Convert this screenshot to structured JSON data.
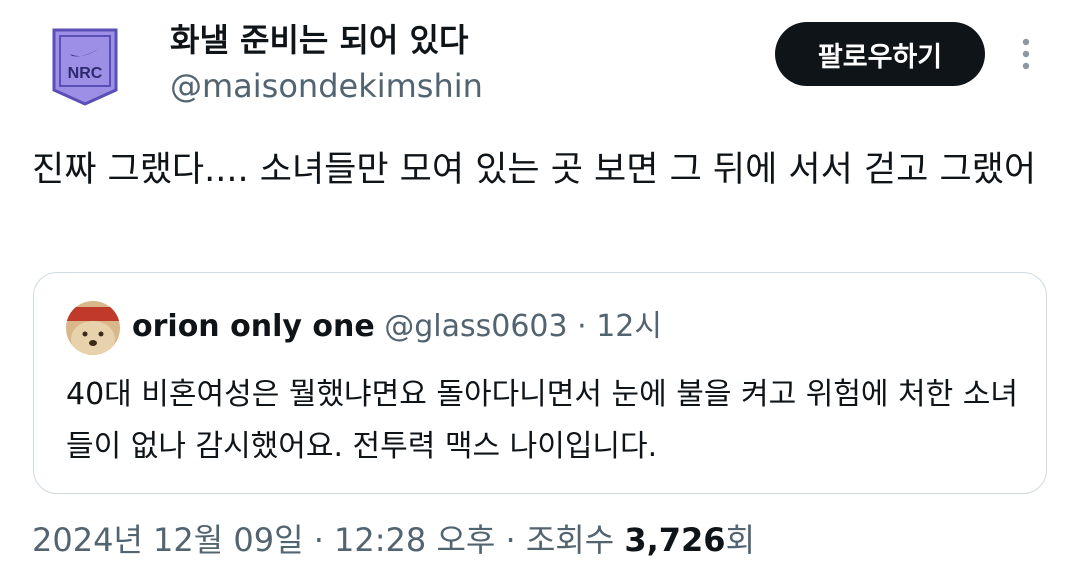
{
  "author": {
    "display_name": "화낼 준비는 되어 있다",
    "handle": "@maisondekimshin",
    "avatar_text": "NRC",
    "avatar_color": "#9d8fe6"
  },
  "actions": {
    "follow_label": "팔로우하기",
    "more_icon": "more-vertical-icon"
  },
  "tweet": {
    "text": "진짜 그랬다.... 소녀들만 모여 있는 곳 보면 그 뒤에 서서 걷고 그랬어"
  },
  "quote": {
    "name": "orion only one",
    "meta": "@glass0603 · 12시",
    "text": "40대 비혼여성은 뭘했냐면요 돌아다니면서 눈에 불을 켜고 위험에 처한 소녀들이 없나 감시했어요. 전투력 맥스 나이입니다."
  },
  "footer": {
    "datetime": "2024년 12월 09일 · 12:28 오후 · 조회수 ",
    "views_count": "3,726",
    "views_suffix": "회"
  },
  "colors": {
    "text_primary": "#0f1419",
    "text_secondary": "#536471",
    "border": "#cfd9de",
    "follow_bg": "#0f1419"
  }
}
